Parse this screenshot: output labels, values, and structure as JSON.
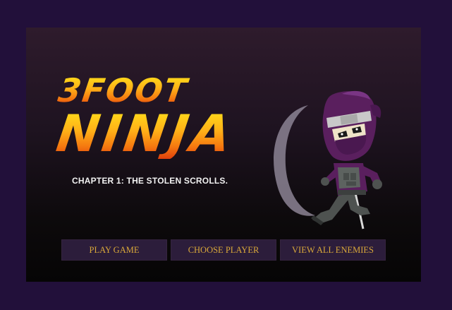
{
  "logo": {
    "line1": "3FOOT",
    "line2": "NINJA"
  },
  "subtitle": "CHAPTER 1: THE STOLEN SCROLLS.",
  "menu": {
    "play_label": "PLAY GAME",
    "choose_label": "CHOOSE PLAYER",
    "enemies_label": "VIEW ALL ENEMIES"
  },
  "colors": {
    "page_background": "#22103a",
    "button_background": "#2c1d3b",
    "button_text": "#d9a83a",
    "logo_top": "#ffe21a",
    "logo_bottom": "#e0400c",
    "ninja_suit": "#5a1f5e"
  },
  "character": {
    "icon": "ninja-character"
  }
}
